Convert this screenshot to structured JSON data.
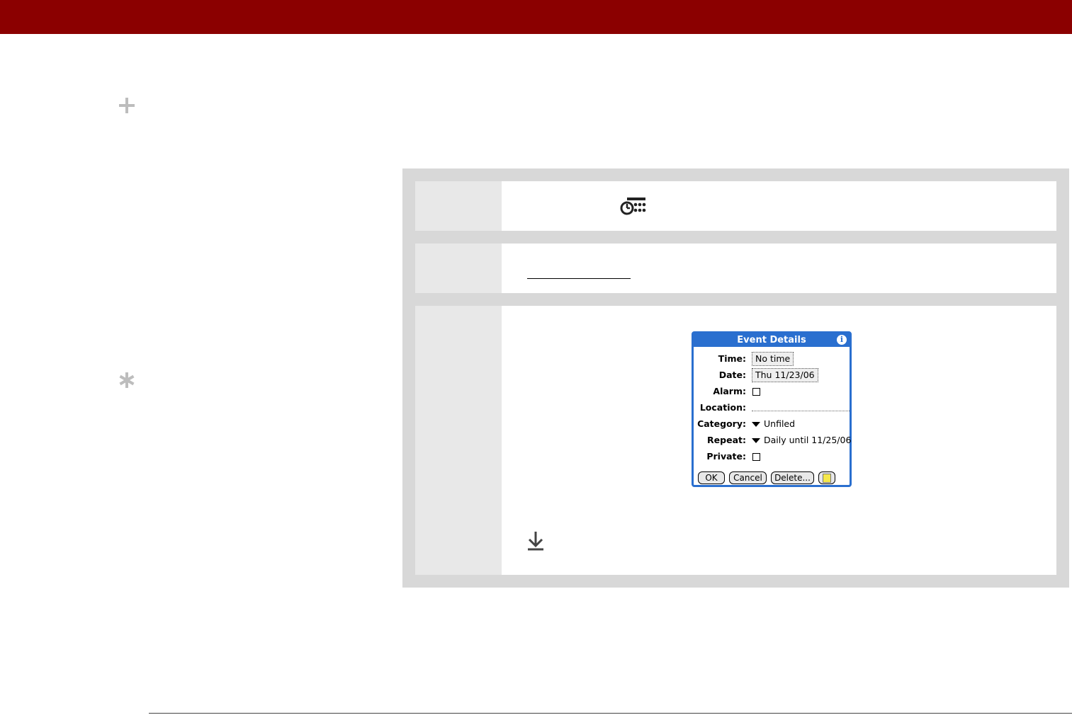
{
  "dialog": {
    "title": "Event Details",
    "fields": {
      "time_label": "Time:",
      "time_value": "No time",
      "date_label": "Date:",
      "date_value": "Thu 11/23/06",
      "alarm_label": "Alarm:",
      "location_label": "Location:",
      "category_label": "Category:",
      "category_value": "Unfiled",
      "repeat_label": "Repeat:",
      "repeat_value": "Daily until 11/25/06",
      "private_label": "Private:"
    },
    "buttons": {
      "ok": "OK",
      "cancel": "Cancel",
      "delete": "Delete..."
    }
  },
  "icons": [
    "plus-icon",
    "asterisk-icon",
    "calendar-clock-icon",
    "info-icon",
    "note-icon",
    "download-icon"
  ],
  "colors": {
    "header_bar": "#8b0000",
    "palm_accent": "#2a6fcf",
    "panel_gray": "#d8d8d8"
  }
}
